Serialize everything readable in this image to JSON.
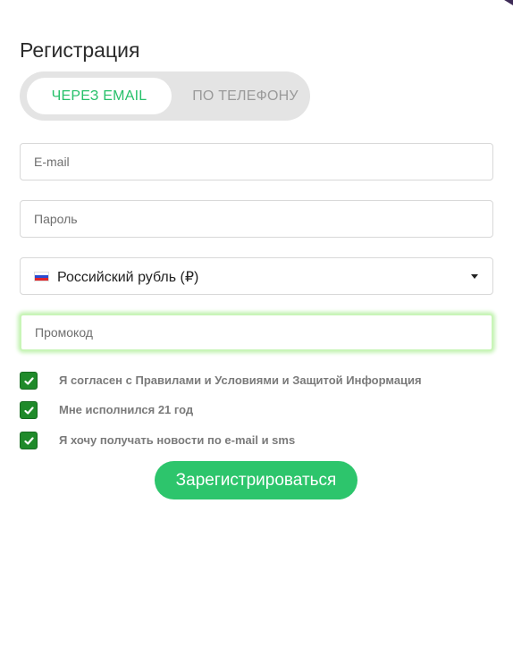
{
  "form": {
    "title": "Регистрация",
    "tabs": [
      {
        "label": "ЧЕРЕЗ EMAIL",
        "active": true
      },
      {
        "label": "ПО ТЕЛЕФОНУ",
        "active": false
      }
    ],
    "fields": {
      "email_placeholder": "E-mail",
      "password_placeholder": "Пароль",
      "promo_placeholder": "Промокод"
    },
    "currency": {
      "selected": "Российский рубль (₽)",
      "flag_icon": "russia-flag-icon"
    },
    "checkboxes": [
      {
        "label": "Я согласен с Правилами и Условиями и Защитой Информация",
        "checked": true
      },
      {
        "label": "Мне исполнился 21 год",
        "checked": true
      },
      {
        "label": "Я хочу получать новости по e-mail и sms",
        "checked": true
      }
    ],
    "submit_label": "Зарегистрироваться"
  },
  "colors": {
    "accent": "#2dc56c",
    "active_tab_text": "#27c06a",
    "checkbox": "#1f8a2a",
    "promo_glow": "#c4f2b4"
  }
}
